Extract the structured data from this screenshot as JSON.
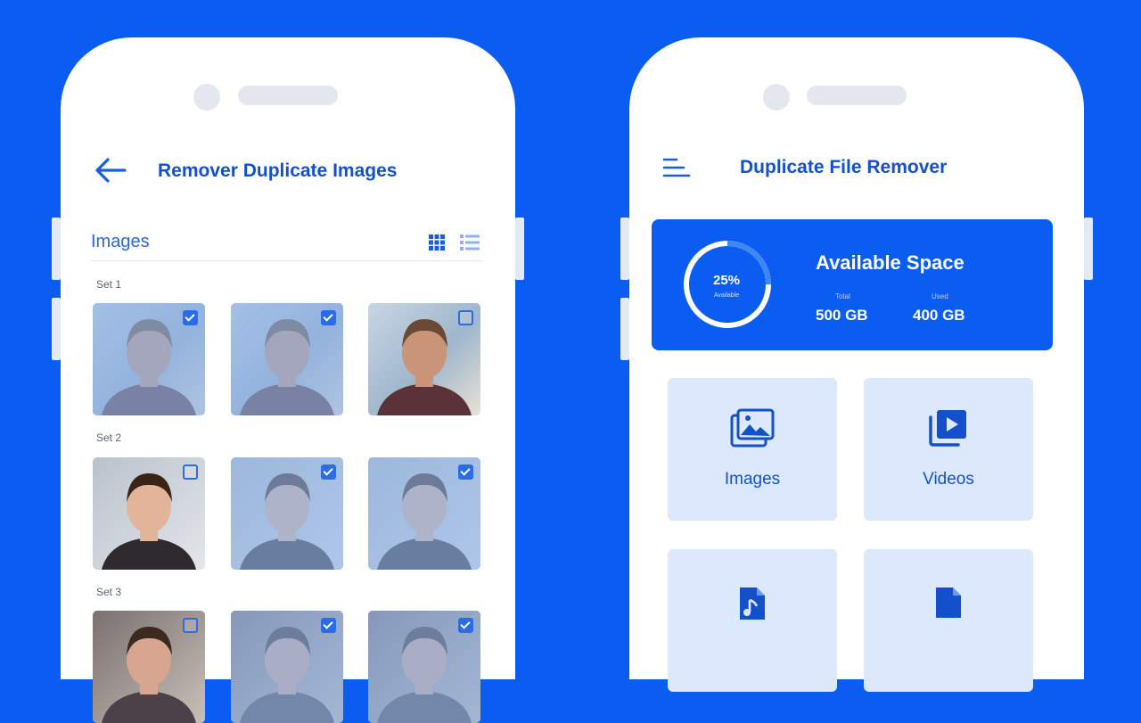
{
  "left_screen": {
    "title": "Remover Duplicate Images",
    "section_label": "Images",
    "sets": [
      {
        "label": "Set 1",
        "images": [
          {
            "person": "man with beard",
            "checked": true,
            "faded": true
          },
          {
            "person": "man with beard",
            "checked": true,
            "faded": true
          },
          {
            "person": "man with beard",
            "checked": false,
            "faded": false
          }
        ]
      },
      {
        "label": "Set 2",
        "images": [
          {
            "person": "young man in suit",
            "checked": false,
            "faded": false
          },
          {
            "person": "young man in suit",
            "checked": true,
            "faded": true
          },
          {
            "person": "young man in suit",
            "checked": true,
            "faded": true
          }
        ]
      },
      {
        "label": "Set 3",
        "images": [
          {
            "person": "portrait",
            "checked": false,
            "faded": false
          },
          {
            "person": "portrait",
            "checked": true,
            "faded": true
          },
          {
            "person": "portrait",
            "checked": true,
            "faded": true
          }
        ]
      }
    ],
    "icons": [
      "back-arrow-icon",
      "grid-view-icon",
      "list-view-icon",
      "checkbox-icon"
    ]
  },
  "right_screen": {
    "title": "Duplicate File Remover",
    "storage": {
      "title": "Available Space",
      "percent_label": "25%",
      "percent_value": 25,
      "percent_sublabel": "Available",
      "total_label": "Total",
      "total_value": "500 GB",
      "used_label": "Used",
      "used_value": "400 GB"
    },
    "categories": [
      {
        "label": "Images",
        "icon": "images-icon"
      },
      {
        "label": "Videos",
        "icon": "video-icon"
      },
      {
        "label": "",
        "icon": "audio-file-icon"
      },
      {
        "label": "",
        "icon": "document-icon"
      }
    ],
    "icons": [
      "menu-icon"
    ]
  },
  "colors": {
    "background": "#0b5cf0",
    "accent": "#1550cc",
    "tile": "#dce8fc",
    "card": "#0b5cf0"
  }
}
